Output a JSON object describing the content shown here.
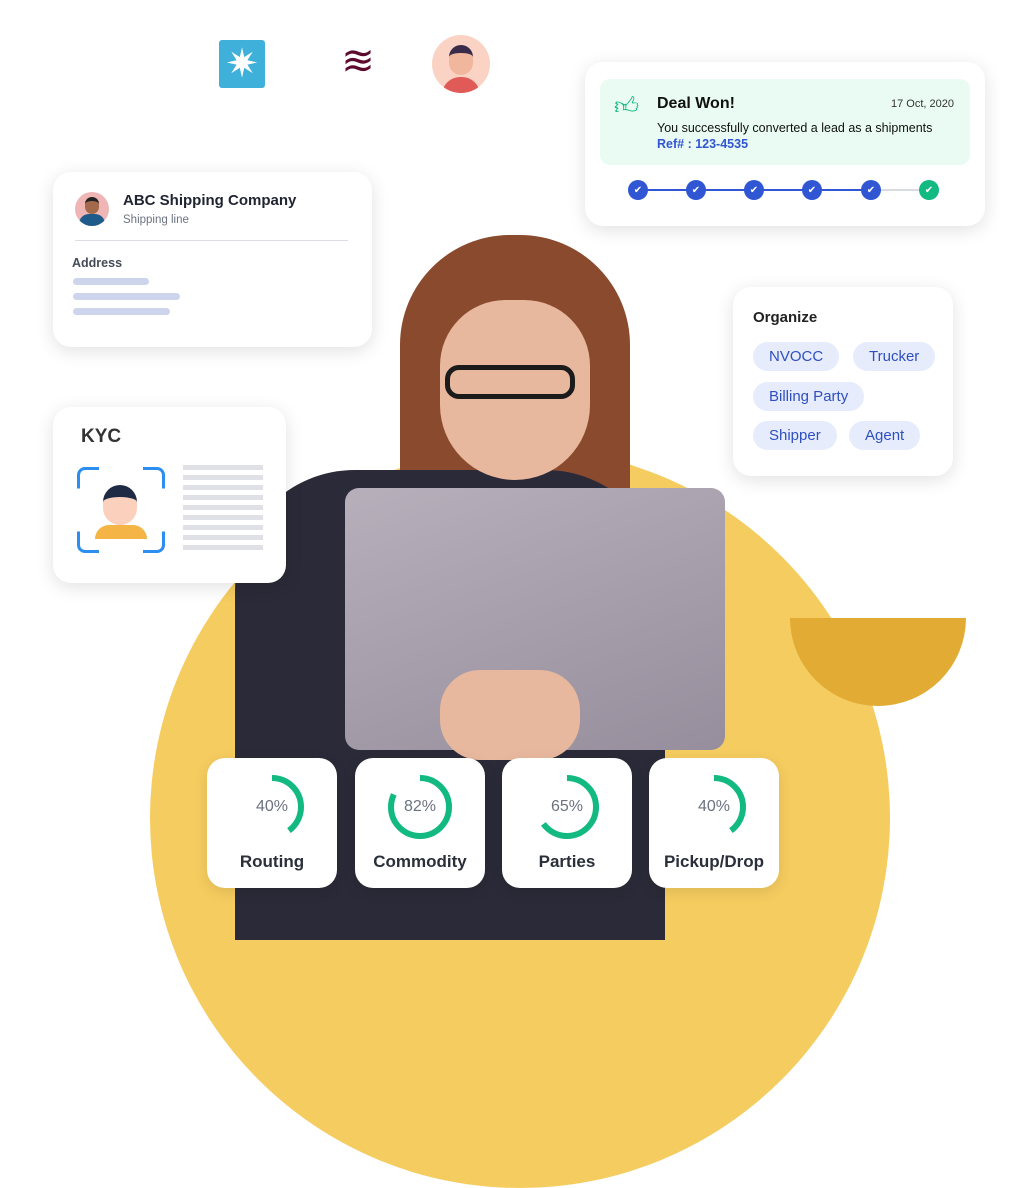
{
  "logos": [
    {
      "name": "maersk-star-icon",
      "color": "#3fb0da"
    },
    {
      "name": "qatar-oryx-icon",
      "color": "#5c0a2e"
    }
  ],
  "deal": {
    "title": "Deal Won!",
    "date": "17 Oct, 2020",
    "message": "You successfully converted a lead as a shipments",
    "ref": "Ref# : 123-4535",
    "steps_completed": 6,
    "steps_total": 6
  },
  "company": {
    "name": "ABC Shipping Company",
    "type": "Shipping line",
    "address_label": "Address"
  },
  "kyc": {
    "title": "KYC"
  },
  "organize": {
    "title": "Organize",
    "tags": [
      "NVOCC",
      "Trucker",
      "Billing Party",
      "Shipper",
      "Agent"
    ]
  },
  "stats": [
    {
      "label": "Routing",
      "value": 40,
      "text": "40%"
    },
    {
      "label": "Commodity",
      "value": 82,
      "text": "82%"
    },
    {
      "label": "Parties",
      "value": 65,
      "text": "65%"
    },
    {
      "label": "Pickup/Drop",
      "value": 40,
      "text": "40%"
    }
  ],
  "colors": {
    "accent": "#3056d3",
    "success": "#12b981",
    "yellow": "#f5cc5f",
    "deal_bg": "#e9fbf3"
  }
}
